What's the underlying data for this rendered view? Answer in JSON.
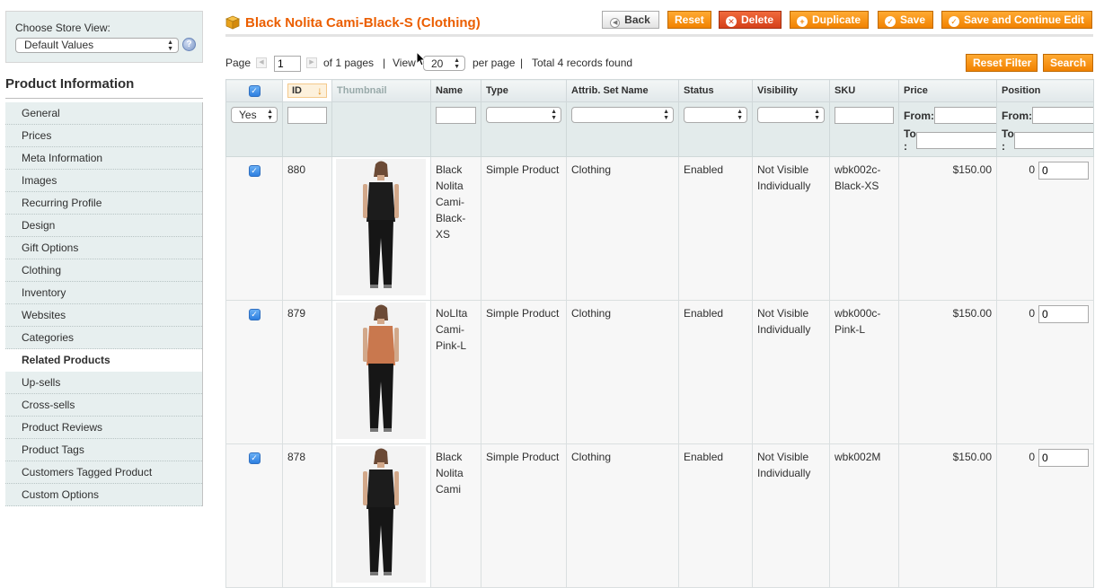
{
  "sidebar": {
    "store_label": "Choose Store View:",
    "store_value": "Default Values",
    "help_glyph": "?",
    "title": "Product Information",
    "tabs": [
      {
        "label": "General"
      },
      {
        "label": "Prices"
      },
      {
        "label": "Meta Information"
      },
      {
        "label": "Images"
      },
      {
        "label": "Recurring Profile"
      },
      {
        "label": "Design"
      },
      {
        "label": "Gift Options"
      },
      {
        "label": "Clothing"
      },
      {
        "label": "Inventory"
      },
      {
        "label": "Websites"
      },
      {
        "label": "Categories"
      },
      {
        "label": "Related Products",
        "active": true
      },
      {
        "label": "Up-sells"
      },
      {
        "label": "Cross-sells"
      },
      {
        "label": "Product Reviews"
      },
      {
        "label": "Product Tags"
      },
      {
        "label": "Customers Tagged Product"
      },
      {
        "label": "Custom Options"
      }
    ]
  },
  "header": {
    "title": "Black Nolita Cami-Black-S (Clothing)",
    "buttons": {
      "back": "Back",
      "reset": "Reset",
      "delete": "Delete",
      "duplicate": "Duplicate",
      "save": "Save",
      "save_continue": "Save and Continue Edit"
    }
  },
  "pager": {
    "page_label": "Page",
    "page_value": "1",
    "of_pages": "of 1 pages",
    "sep": "|",
    "view_label": "View",
    "per_page_value": "20",
    "per_page_label": "per page",
    "total": "Total 4 records found",
    "reset_filter": "Reset Filter",
    "search": "Search"
  },
  "grid": {
    "columns": {
      "id": "ID",
      "thumbnail": "Thumbnail",
      "name": "Name",
      "type": "Type",
      "attrib_set": "Attrib. Set Name",
      "status": "Status",
      "visibility": "Visibility",
      "sku": "SKU",
      "price": "Price",
      "position": "Position"
    },
    "filters": {
      "in_products": "Yes",
      "from_label": "From:",
      "to_label": "To :"
    },
    "rows": [
      {
        "checked": true,
        "id": "880",
        "name": "Black Nolita Cami-Black-XS",
        "type": "Simple Product",
        "attrib_set": "Clothing",
        "status": "Enabled",
        "visibility": "Not Visible Individually",
        "sku": "wbk002c-Black-XS",
        "price": "$150.00",
        "position_text": "0",
        "position_value": "0",
        "top_color": "#1c1c1c"
      },
      {
        "checked": true,
        "id": "879",
        "name": "NoLIta Cami-Pink-L",
        "type": "Simple Product",
        "attrib_set": "Clothing",
        "status": "Enabled",
        "visibility": "Not Visible Individually",
        "sku": "wbk000c-Pink-L",
        "price": "$150.00",
        "position_text": "0",
        "position_value": "0",
        "top_color": "#c9784e"
      },
      {
        "checked": true,
        "id": "878",
        "name": "Black Nolita Cami",
        "type": "Simple Product",
        "attrib_set": "Clothing",
        "status": "Enabled",
        "visibility": "Not Visible Individually",
        "sku": "wbk002M",
        "price": "$150.00",
        "position_text": "0",
        "position_value": "0",
        "top_color": "#1c1c1c"
      }
    ]
  }
}
